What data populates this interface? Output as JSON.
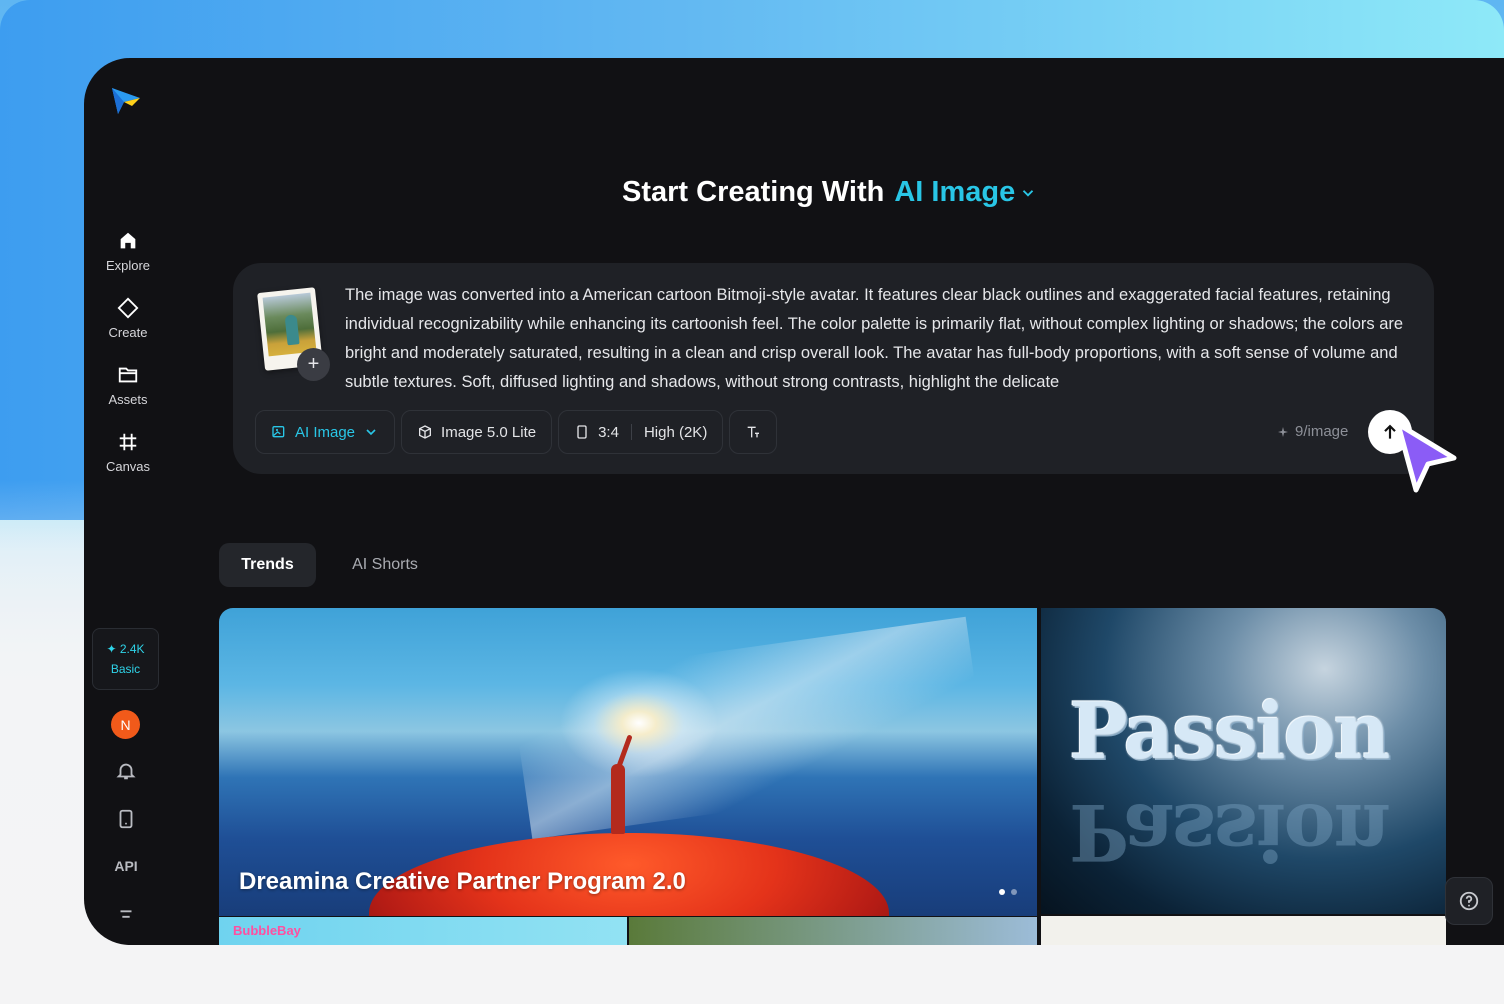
{
  "sidebar": {
    "logo_icon": "dreamina-logo-icon",
    "items": [
      {
        "label": "Explore",
        "icon": "home-icon"
      },
      {
        "label": "Create",
        "icon": "diamond-icon"
      },
      {
        "label": "Assets",
        "icon": "folder-icon"
      },
      {
        "label": "Canvas",
        "icon": "crop-icon"
      }
    ],
    "credits": {
      "amount": "✦ 2.4K",
      "plan": "Basic"
    },
    "avatar_initial": "N",
    "api_label": "API"
  },
  "header": {
    "prefix": "Start Creating With",
    "mode": "AI Image"
  },
  "prompt": {
    "text": "The image was converted into a American cartoon Bitmoji-style avatar. It features clear black outlines and exaggerated facial features, retaining individual recognizability while enhancing its cartoonish feel. The color palette is primarily flat, without complex lighting or shadows; the colors are bright and moderately saturated, resulting in a clean and crisp overall look. The avatar has full-body proportions, with a soft sense of volume and subtle textures. Soft, diffused lighting and shadows, without strong contrasts, highlight the delicate",
    "add_label": "+",
    "toolbar": {
      "mode": "AI Image",
      "model": "Image 5.0 Lite",
      "ratio": "3:4",
      "quality": "High (2K)"
    },
    "cost": "9/image"
  },
  "tabs": [
    "Trends",
    "AI Shorts"
  ],
  "gallery": {
    "hero_title": "Dreamina Creative Partner Program 2.0",
    "side_word": "Passion",
    "mini1_label": "BubbleBay"
  },
  "colors": {
    "accent": "#29c6e6",
    "background": "#111114",
    "card": "#1f2126"
  }
}
